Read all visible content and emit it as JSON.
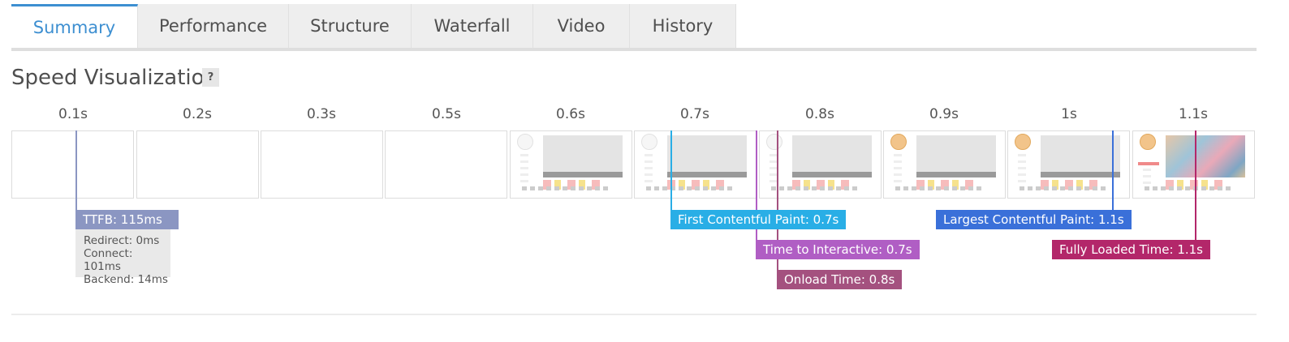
{
  "tabs": [
    "Summary",
    "Performance",
    "Structure",
    "Waterfall",
    "Video",
    "History"
  ],
  "active_tab": "Summary",
  "section": {
    "title": "Speed Visualization",
    "help": "?"
  },
  "timeline": [
    "0.1s",
    "0.2s",
    "0.3s",
    "0.5s",
    "0.6s",
    "0.7s",
    "0.8s",
    "0.9s",
    "1s",
    "1.1s"
  ],
  "frames": [
    "blank",
    "blank",
    "blank",
    "blank",
    "placeholder",
    "placeholder",
    "placeholder",
    "placeholder-avatar",
    "placeholder-avatar",
    "loaded"
  ],
  "ttfb": {
    "label": "TTFB: 115ms",
    "details": [
      "Redirect: 0ms",
      "Connect: 101ms",
      "Backend: 14ms"
    ],
    "color": "#8b96c2"
  },
  "markers": [
    {
      "label": "First Contentful Paint: 0.7s",
      "color": "#29aee6"
    },
    {
      "label": "Time to Interactive: 0.7s",
      "color": "#b05ec4"
    },
    {
      "label": "Onload Time: 0.8s",
      "color": "#a4517f"
    },
    {
      "label": "Largest Contentful Paint: 1.1s",
      "color": "#3a70d9"
    },
    {
      "label": "Fully Loaded Time: 1.1s",
      "color": "#b3276a"
    }
  ]
}
